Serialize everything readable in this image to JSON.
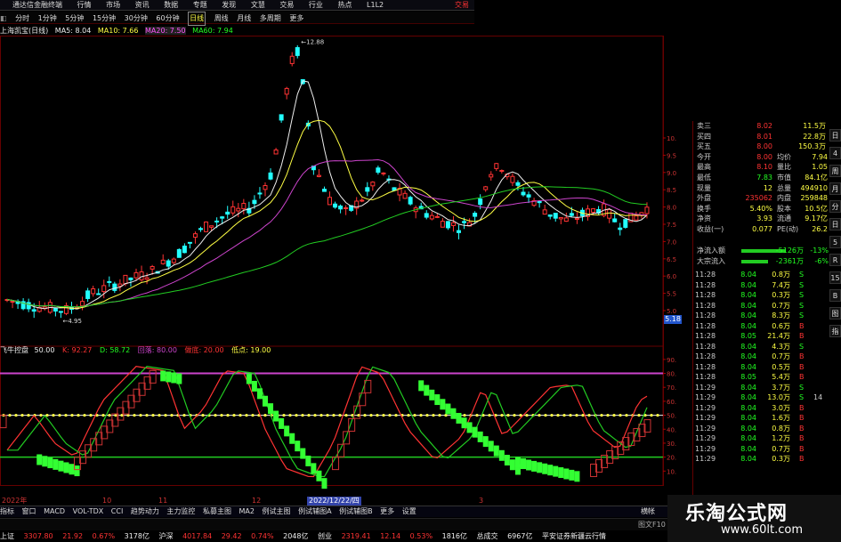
{
  "titlebar": {
    "app_title": "通达信金融终端",
    "menu": [
      "行情",
      "市场",
      "资讯",
      "数据",
      "专题",
      "发现",
      "文慧",
      "交易",
      "行业",
      "热点",
      "L1L2"
    ],
    "right_label": "交易"
  },
  "periods": [
    "分时",
    "1分钟",
    "5分钟",
    "15分钟",
    "30分钟",
    "60分钟",
    "日线",
    "周线",
    "月线",
    "多周期",
    "更多"
  ],
  "active_period": "日线",
  "stock": {
    "name_label": "上海凯宝(日线)",
    "ma5": "MA5: 8.04",
    "ma10": "MA10: 7.66",
    "ma20": "MA20: 7.50",
    "ma60": "MA60: 7.94",
    "peak_label": "12.88",
    "low_label": "4.95",
    "current_price_marker": "5.18"
  },
  "main_price_axis": [
    "10.00",
    "9.50",
    "9.00",
    "8.50",
    "8.00",
    "7.50",
    "7.00",
    "6.50",
    "6.00",
    "5.50",
    "5.00"
  ],
  "indicator": {
    "name": "飞牛控盘",
    "value": "50.00",
    "k": "K: 92.27",
    "d": "D: 58.72",
    "l1": "回落: 80.00",
    "l2": "做底: 20.00",
    "l3": "低点: 19.00",
    "axis": [
      "90.00",
      "80.00",
      "70.00",
      "60.00",
      "50.00",
      "40.00",
      "30.00",
      "20.00",
      "10.00"
    ]
  },
  "date_axis": {
    "left": "2022年",
    "ticks": [
      "10",
      "11",
      "12",
      "3"
    ],
    "highlight": "2022/12/22/四"
  },
  "quote": [
    {
      "k": "卖三",
      "v": "8.02",
      "v2": "11.5万",
      "vc": "red",
      "v2c": "yellow"
    },
    {
      "k": "买四",
      "v": "8.01",
      "v2": "22.8万",
      "vc": "red",
      "v2c": "yellow"
    },
    {
      "k": "买五",
      "v": "8.00",
      "v2": "150.3万",
      "vc": "red",
      "v2c": "yellow"
    },
    {
      "k": "今开",
      "v": "8.00",
      "v2": "均价",
      "v3": "7.94",
      "vc": "red"
    },
    {
      "k": "最高",
      "v": "8.10",
      "v2": "量比",
      "v3": "1.05",
      "vc": "red"
    },
    {
      "k": "最低",
      "v": "7.83",
      "v2": "市值",
      "v3": "84.1亿",
      "vc": "green"
    },
    {
      "k": "现量",
      "v": "12",
      "v2": "总量",
      "v3": "494910",
      "vc": "yellow"
    },
    {
      "k": "外盘",
      "v": "235062",
      "v2": "内盘",
      "v3": "259848",
      "vc": "red"
    },
    {
      "k": "换手",
      "v": "5.40%",
      "v2": "股本",
      "v3": "10.5亿",
      "vc": "yellow"
    },
    {
      "k": "净资",
      "v": "3.93",
      "v2": "流通",
      "v3": "9.17亿",
      "vc": "yellow"
    },
    {
      "k": "收益(一)",
      "v": "0.077",
      "v2": "PE(动)",
      "v3": "26.2",
      "vc": "yellow"
    }
  ],
  "netflow": [
    {
      "k": "净流入额",
      "v": "-5126万",
      "v2": "-13%"
    },
    {
      "k": "大宗流入",
      "v": "-2361万",
      "v2": "-6%"
    }
  ],
  "ticks": [
    {
      "t": "11:28",
      "p": "8.04",
      "q": "0.8万",
      "s": "S"
    },
    {
      "t": "11:28",
      "p": "8.04",
      "q": "7.4万",
      "s": "S"
    },
    {
      "t": "11:28",
      "p": "8.04",
      "q": "0.3万",
      "s": "S"
    },
    {
      "t": "11:28",
      "p": "8.04",
      "q": "0.7万",
      "s": "S"
    },
    {
      "t": "11:28",
      "p": "8.04",
      "q": "8.3万",
      "s": "S"
    },
    {
      "t": "11:28",
      "p": "8.04",
      "q": "0.6万",
      "s": "B"
    },
    {
      "t": "11:28",
      "p": "8.05",
      "q": "21.4万",
      "s": "B"
    },
    {
      "t": "11:28",
      "p": "8.04",
      "q": "4.3万",
      "s": "S"
    },
    {
      "t": "11:28",
      "p": "8.04",
      "q": "0.7万",
      "s": "B"
    },
    {
      "t": "11:28",
      "p": "8.04",
      "q": "0.5万",
      "s": "B"
    },
    {
      "t": "11:28",
      "p": "8.05",
      "q": "5.4万",
      "s": "B"
    },
    {
      "t": "11:29",
      "p": "8.04",
      "q": "3.7万",
      "s": "S"
    },
    {
      "t": "11:29",
      "p": "8.04",
      "q": "13.0万",
      "s": "S"
    },
    {
      "t": "11:29",
      "p": "8.04",
      "q": "3.0万",
      "s": "B"
    },
    {
      "t": "11:29",
      "p": "8.04",
      "q": "1.6万",
      "s": "B"
    },
    {
      "t": "11:29",
      "p": "8.04",
      "q": "0.8万",
      "s": "B"
    },
    {
      "t": "11:29",
      "p": "8.04",
      "q": "1.2万",
      "s": "B"
    },
    {
      "t": "11:29",
      "p": "8.04",
      "q": "0.7万",
      "s": "B"
    },
    {
      "t": "11:29",
      "p": "8.04",
      "q": "0.3万",
      "s": "B"
    }
  ],
  "tick_extra": "14",
  "indicator_tabs": [
    "指标",
    "窗口",
    "MACD",
    "VOL-TDX",
    "CCI",
    "趋势动力",
    "主力监控",
    "私募主图",
    "MA2",
    "例试主图",
    "例试辅图A",
    "例试辅图B",
    "更多",
    "设置"
  ],
  "statusbar": {
    "sh_label": "上证",
    "sh_val": "3307.80",
    "sh_chg": "21.92",
    "sh_pct": "0.67%",
    "sh_amt": "3178亿",
    "sz_label": "沪深",
    "sz_val": "4017.84",
    "sz_chg": "29.42",
    "sz_pct": "0.74%",
    "sz_amt": "2048亿",
    "cy_label": "创业",
    "cy_val": "2319.41",
    "cy_chg": "12.14",
    "cy_pct": "0.53%",
    "cy_amt": "1816亿",
    "total_label": "总成交",
    "total_val": "6967亿",
    "broker": "平安证券新疆云行情"
  },
  "bottom_right_label": "图文F10",
  "bottom_right_label2": "横帐",
  "vtabs": [
    "日",
    "4",
    "周",
    "月",
    "分",
    "日",
    "5",
    "R",
    "15",
    "B",
    "图",
    "指"
  ],
  "watermark": {
    "line1": "乐淘公式网",
    "line2": "www.60lt.com"
  },
  "colors": {
    "up": "#ff3333",
    "down": "#22ff22",
    "yellow": "#ffff44",
    "magenta": "#cc44cc",
    "grid": "#550000"
  }
}
